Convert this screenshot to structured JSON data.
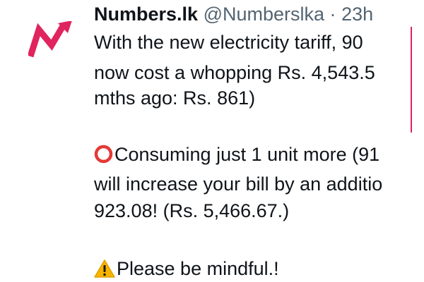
{
  "tweet": {
    "display_name": "Numbers.lk",
    "handle": "@Numberslka",
    "separator": "·",
    "time": "23h",
    "lines": [
      "With the new electricity tariff, 90",
      "now cost a whopping Rs. 4,543.5",
      "mths ago: Rs. 861)",
      "Consuming just 1 unit more (91",
      "will increase your bill by an additio",
      "923.08! (Rs. 5,466.67.)",
      "Please be mindful.!"
    ],
    "icons": {
      "avatar": "numbers-lk-logo",
      "line4_prefix": "red-circle-emoji",
      "line7_prefix": "warning-emoji"
    }
  },
  "colors": {
    "text": "#0f1419",
    "secondary": "#536471",
    "logo_red": "#e0245e",
    "circle_red": "#e53935",
    "warning_yellow": "#f7b500"
  }
}
